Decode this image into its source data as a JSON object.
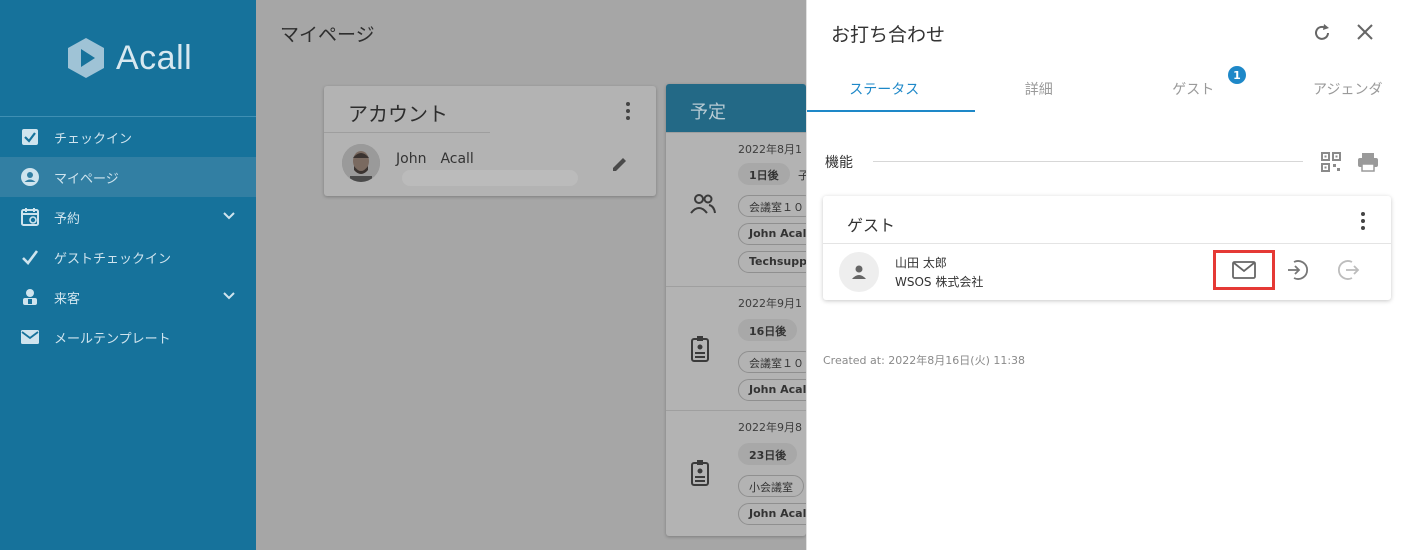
{
  "sidebar": {
    "brand": "Acall",
    "items": [
      {
        "label": "チェックイン",
        "icon": "checkbox-icon"
      },
      {
        "label": "マイページ",
        "icon": "account-circle-icon"
      },
      {
        "label": "予約",
        "icon": "calendar-icon"
      },
      {
        "label": "ゲストチェックイン",
        "icon": "check-icon"
      },
      {
        "label": "来客",
        "icon": "visitor-icon"
      },
      {
        "label": "メールテンプレート",
        "icon": "mail-icon"
      }
    ]
  },
  "main": {
    "title": "マイページ",
    "account": {
      "title": "アカウント",
      "name": "John　Acall"
    },
    "schedule": {
      "title": "予定",
      "rows": [
        {
          "date": "2022年8月1",
          "days": "1日後",
          "days_extra": "子",
          "room": "会議室１０",
          "host": "John Acall",
          "org": "Techsuppo"
        },
        {
          "date": "2022年9月1",
          "days": "16日後",
          "room": "会議室１０",
          "host": "John Acall"
        },
        {
          "date": "2022年9月8",
          "days": "23日後",
          "room": "小会議室",
          "host": "John Acall"
        }
      ]
    }
  },
  "panel": {
    "title": "お打ち合わせ",
    "tabs": [
      {
        "label": "ステータス"
      },
      {
        "label": "詳細"
      },
      {
        "label": "ゲスト",
        "badge": "1"
      },
      {
        "label": "アジェンダ"
      }
    ],
    "section_label": "機能",
    "guest_card": {
      "title": "ゲスト",
      "guest_name": "山田 太郎",
      "guest_company": "WSOS 株式会社"
    },
    "created_at": "Created at: 2022年8月16日(火) 11:38"
  },
  "colors": {
    "sidebar": "#16729b",
    "accent": "#1e88c8",
    "highlight": "#e53935"
  }
}
